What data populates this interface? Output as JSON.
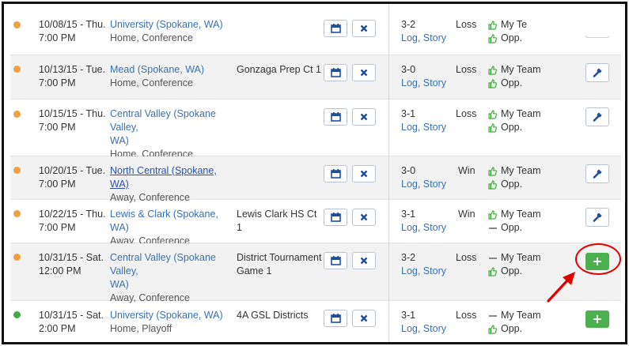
{
  "colors": {
    "dot_orange": "#f0a040",
    "dot_green": "#3faa3f",
    "link_blue": "#3a6fb0",
    "accent_green": "#4caf50",
    "highlight_red": "#e00000"
  },
  "icons": {
    "calendar": "calendar-icon",
    "remove": "close-icon",
    "edit": "wrench-icon",
    "add": "plus-icon",
    "thumbs_up": "thumbs-up-icon"
  },
  "games": [
    {
      "status_color": "orange",
      "date": "10/08/15 - Thu.",
      "time": "7:00 PM",
      "opponent_line1": "University (Spokane, WA)",
      "opponent_line2": "",
      "type": "Home, Conference",
      "location_line1": "",
      "location_line2": "",
      "score": "3-2",
      "links": "Log, Story",
      "result": "Loss",
      "my_team": "My Te",
      "opp": "Opp.",
      "my_team_icon": "thumb",
      "opp_icon": "thumb",
      "action": "none"
    },
    {
      "status_color": "orange",
      "date": "10/13/15 - Tue.",
      "time": "7:00 PM",
      "opponent_line1": "Mead (Spokane, WA)",
      "opponent_line2": "",
      "type": "Home, Conference",
      "location_line1": "Gonzaga Prep Ct 1",
      "location_line2": "",
      "score": "3-0",
      "links": "Log, Story",
      "result": "Loss",
      "my_team": "My Team",
      "opp": "Opp.",
      "my_team_icon": "thumb",
      "opp_icon": "thumb",
      "action": "edit"
    },
    {
      "status_color": "orange",
      "date": "10/15/15 - Thu.",
      "time": "7:00 PM",
      "opponent_line1": "Central Valley (Spokane Valley,",
      "opponent_line2": "WA)",
      "type": "Home, Conference",
      "location_line1": "",
      "location_line2": "",
      "score": "3-1",
      "links": "Log, Story",
      "result": "Loss",
      "my_team": "My Team",
      "opp": "Opp.",
      "my_team_icon": "thumb",
      "opp_icon": "thumb",
      "action": "edit"
    },
    {
      "status_color": "orange",
      "date": "10/20/15 - Tue.",
      "time": "7:00 PM",
      "opponent_line1": "North Central (Spokane, WA)",
      "opponent_line2": "",
      "type": "Away, Conference",
      "location_line1": "",
      "location_line2": "",
      "score": "3-0",
      "links": "Log, Story",
      "result": "Win",
      "my_team": "My Team",
      "opp": "Opp.",
      "my_team_icon": "thumb",
      "opp_icon": "thumb",
      "action": "edit"
    },
    {
      "status_color": "orange",
      "date": "10/22/15 - Thu.",
      "time": "7:00 PM",
      "opponent_line1": "Lewis & Clark (Spokane, WA)",
      "opponent_line2": "",
      "type": "Away, Conference",
      "location_line1": "Lewis Clark HS Ct 1",
      "location_line2": "",
      "score": "3-1",
      "links": "Log, Story",
      "result": "Win",
      "my_team": "My Team",
      "opp": "Opp.",
      "my_team_icon": "thumb",
      "opp_icon": "dash",
      "action": "edit"
    },
    {
      "status_color": "orange",
      "date": "10/31/15 - Sat.",
      "time": "12:00 PM",
      "opponent_line1": "Central Valley (Spokane Valley,",
      "opponent_line2": "WA)",
      "type": "Away, Conference",
      "location_line1": "District Tournament",
      "location_line2": "Game 1",
      "score": "3-2",
      "links": "Log, Story",
      "result": "Loss",
      "my_team": "My Team",
      "opp": "Opp.",
      "my_team_icon": "dash",
      "opp_icon": "thumb",
      "action": "add"
    },
    {
      "status_color": "green",
      "date": "10/31/15 - Sat.",
      "time": "2:00 PM",
      "opponent_line1": "University (Spokane, WA)",
      "opponent_line2": "",
      "type": "Home, Playoff",
      "location_line1": "4A GSL Districts",
      "location_line2": "",
      "score": "3-1",
      "links": "Log, Story",
      "result": "Loss",
      "my_team": "My Team",
      "opp": "Opp.",
      "my_team_icon": "dash",
      "opp_icon": "thumb",
      "action": "add"
    }
  ]
}
